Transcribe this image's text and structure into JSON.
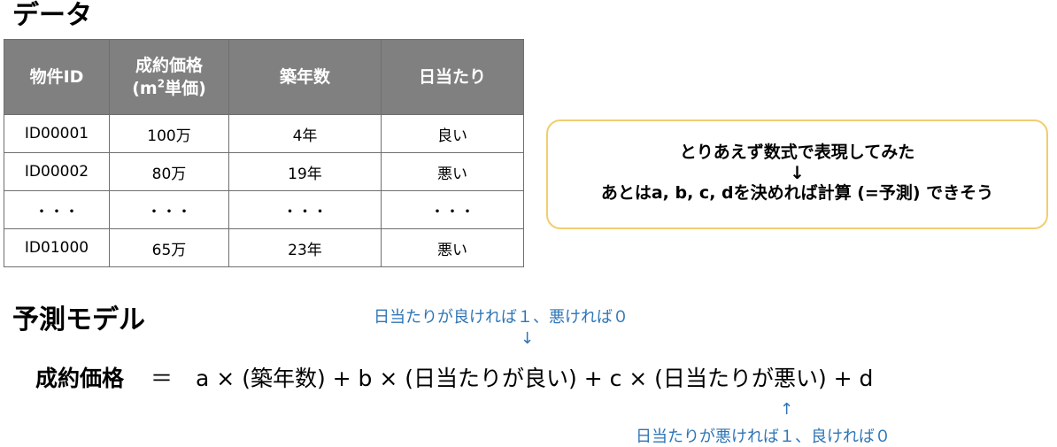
{
  "data_section": {
    "title": "データ",
    "table": {
      "headers": [
        "物件ID",
        "成約価格",
        "(m",
        "2",
        "単価)",
        "築年数",
        "日当たり"
      ],
      "rows": [
        [
          "ID00001",
          "100万",
          "4年",
          "良い"
        ],
        [
          "ID00002",
          "80万",
          "19年",
          "悪い"
        ],
        [
          "・・・",
          "・・・",
          "・・・",
          "・・・"
        ],
        [
          "ID01000",
          "65万",
          "23年",
          "悪い"
        ]
      ]
    }
  },
  "note_box": {
    "line1": "とりあえず数式で表現してみた",
    "arrow": "↓",
    "line2": "あとはa, b, c, dを決めれば計算 (=予測) できそう"
  },
  "model_section": {
    "title": "予測モデル",
    "note_top": "日当たりが良ければ１、悪ければ０",
    "note_top_arrow": "↓",
    "formula_lhs": "成約価格",
    "formula_eq": "＝",
    "formula_rhs": "a × (築年数) + b × (日当たりが良い) + c × (日当たりが悪い) + d",
    "note_bottom_arrow": "↑",
    "note_bottom": "日当たりが悪ければ１、良ければ０"
  },
  "colors": {
    "header_bg": "#808080",
    "box_border": "#f2cd6f",
    "note_text": "#2e75b6"
  }
}
